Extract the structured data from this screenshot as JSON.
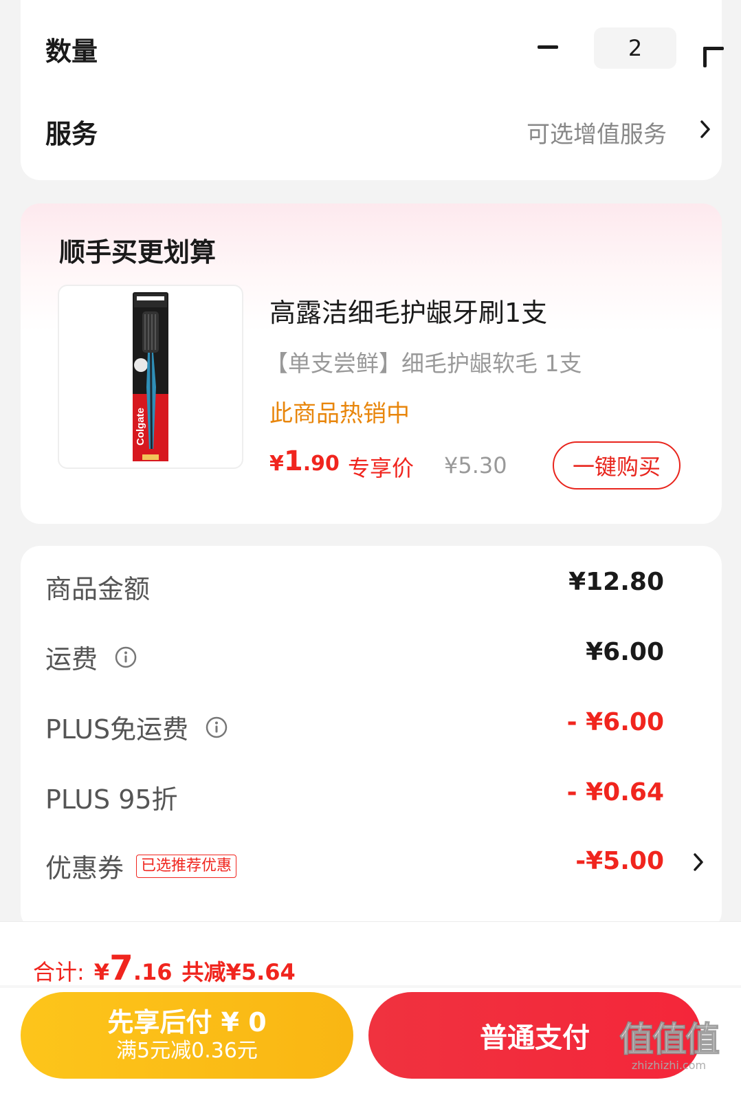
{
  "order": {
    "quantity_label": "数量",
    "quantity_value": "2",
    "service_label": "服务",
    "service_value": "可选增值服务"
  },
  "recommend": {
    "title": "顺手买更划算",
    "product": {
      "name": "高露洁细毛护龈牙刷1支",
      "spec": "【单支尝鲜】细毛护龈软毛 1支",
      "hot_text": "此商品热销中",
      "price_currency": "¥",
      "price_int": "1",
      "price_dec": ".90",
      "price_tag": "专享价",
      "original_price": "¥5.30",
      "buy_label": "一键购买",
      "image_brand": "Colgate"
    }
  },
  "summary": {
    "rows": [
      {
        "label": "商品金额",
        "amount": "¥12.80"
      },
      {
        "label": "运费",
        "amount": "¥6.00"
      },
      {
        "label": "PLUS免运费",
        "amount": "- ¥6.00"
      },
      {
        "label": "PLUS 95折",
        "amount": "- ¥0.64"
      },
      {
        "label": "优惠券",
        "tag": "已选推荐优惠",
        "amount": "-¥5.00"
      }
    ]
  },
  "footer": {
    "total_label": "合计:",
    "total_currency": "¥",
    "total_int": "7",
    "total_dec": ".16",
    "total_saving": "共减¥5.64",
    "later_pay_title": "先享后付 ¥ 0",
    "later_pay_sub": "满5元减0.36元",
    "pay_label": "普通支付"
  },
  "watermark": {
    "text": "值值值",
    "site": "zhizhizhi.com"
  },
  "colors": {
    "accent_red": "#f0251e",
    "hot_orange": "#e8860c",
    "pay_yellow": "#fdc51b",
    "pay_red": "#f0323f"
  },
  "icons": [
    "minus-icon",
    "plus-icon",
    "chevron-right-icon",
    "info-icon"
  ]
}
